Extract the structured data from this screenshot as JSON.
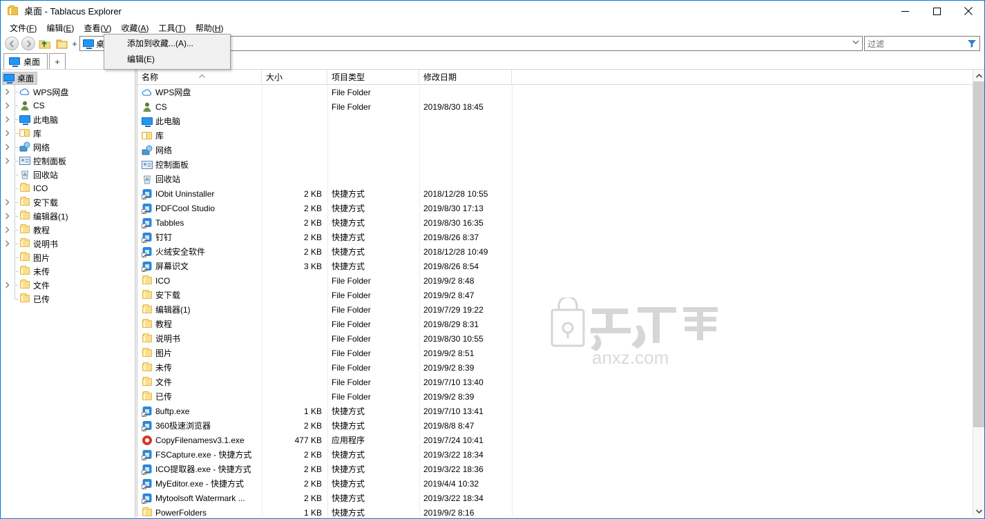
{
  "window": {
    "title": "桌面 - Tablacus Explorer",
    "icon": "folder-icon",
    "controls": {
      "minimize": "–",
      "maximize": "□",
      "close": "✕"
    },
    "accent_color": "#0078d7"
  },
  "menubar": {
    "items": [
      {
        "label": "文件",
        "accel": "F"
      },
      {
        "label": "编辑",
        "accel": "E"
      },
      {
        "label": "查看",
        "accel": "V"
      },
      {
        "label": "收藏",
        "accel": "A"
      },
      {
        "label": "工具",
        "accel": "T"
      },
      {
        "label": "帮助",
        "accel": "H"
      }
    ]
  },
  "open_menu": {
    "parent": "收藏(A)",
    "items": [
      {
        "label": "添加到收藏...(A)..."
      },
      {
        "label": "编辑(E)"
      }
    ]
  },
  "toolbar": {
    "back_icon": "back-arrow-icon",
    "forward_icon": "forward-arrow-icon",
    "up_icon": "up-folder-icon",
    "folder_icon": "folder-icon",
    "plus_label": "+",
    "address": {
      "crumb": "桌面",
      "chevron": "⌄"
    },
    "filter": {
      "placeholder": "过滤",
      "icon": "funnel-icon"
    }
  },
  "tabs": {
    "items": [
      {
        "label": "桌面",
        "icon": "desktop-icon",
        "active": true
      }
    ],
    "add_label": "+"
  },
  "tree": {
    "root": {
      "label": "桌面",
      "icon": "desktop-icon",
      "selected": true
    },
    "items": [
      {
        "label": "WPS网盘",
        "icon": "cloud-icon",
        "expander": true
      },
      {
        "label": "CS",
        "icon": "user-icon",
        "expander": true
      },
      {
        "label": "此电脑",
        "icon": "computer-icon",
        "expander": true
      },
      {
        "label": "库",
        "icon": "library-icon",
        "expander": true
      },
      {
        "label": "网络",
        "icon": "network-icon",
        "expander": true
      },
      {
        "label": "控制面板",
        "icon": "control-panel-icon",
        "expander": true
      },
      {
        "label": "回收站",
        "icon": "recycle-bin-icon",
        "expander": false
      },
      {
        "label": "ICO",
        "icon": "folder-icon",
        "expander": false
      },
      {
        "label": "安下载",
        "icon": "folder-icon",
        "expander": true
      },
      {
        "label": "编辑器(1)",
        "icon": "folder-icon",
        "expander": true
      },
      {
        "label": "教程",
        "icon": "folder-icon",
        "expander": true
      },
      {
        "label": "说明书",
        "icon": "folder-icon",
        "expander": true
      },
      {
        "label": "图片",
        "icon": "folder-icon",
        "expander": false
      },
      {
        "label": "未传",
        "icon": "folder-icon",
        "expander": false
      },
      {
        "label": "文件",
        "icon": "folder-icon",
        "expander": true
      },
      {
        "label": "已传",
        "icon": "folder-icon",
        "expander": false
      }
    ]
  },
  "list": {
    "columns": [
      {
        "label": "名称",
        "sorted": "asc"
      },
      {
        "label": "大小"
      },
      {
        "label": "项目类型"
      },
      {
        "label": "修改日期"
      }
    ],
    "rows": [
      {
        "name": "WPS网盘",
        "icon": "cloud-icon",
        "size": "",
        "type": "File Folder",
        "date": ""
      },
      {
        "name": "CS",
        "icon": "user-icon",
        "size": "",
        "type": "File Folder",
        "date": "2019/8/30 18:45"
      },
      {
        "name": "此电脑",
        "icon": "computer-icon",
        "size": "",
        "type": "",
        "date": ""
      },
      {
        "name": "库",
        "icon": "library-icon",
        "size": "",
        "type": "",
        "date": ""
      },
      {
        "name": "网络",
        "icon": "network-icon",
        "size": "",
        "type": "",
        "date": ""
      },
      {
        "name": "控制面板",
        "icon": "control-panel-icon",
        "size": "",
        "type": "",
        "date": ""
      },
      {
        "name": "回收站",
        "icon": "recycle-bin-icon",
        "size": "",
        "type": "",
        "date": ""
      },
      {
        "name": "IObit Uninstaller",
        "icon": "app-shortcut-icon",
        "size": "2 KB",
        "type": "快捷方式",
        "date": "2018/12/28 10:55"
      },
      {
        "name": "PDFCool Studio",
        "icon": "app-shortcut-icon",
        "size": "2 KB",
        "type": "快捷方式",
        "date": "2019/8/30 17:13"
      },
      {
        "name": "Tabbles",
        "icon": "app-shortcut-icon",
        "size": "2 KB",
        "type": "快捷方式",
        "date": "2019/8/30 16:35"
      },
      {
        "name": "钉钉",
        "icon": "app-shortcut-icon",
        "size": "2 KB",
        "type": "快捷方式",
        "date": "2019/8/26 8:37"
      },
      {
        "name": "火绒安全软件",
        "icon": "app-shortcut-icon",
        "size": "2 KB",
        "type": "快捷方式",
        "date": "2018/12/28 10:49"
      },
      {
        "name": "屏幕识文",
        "icon": "app-shortcut-icon",
        "size": "3 KB",
        "type": "快捷方式",
        "date": "2019/8/26 8:54"
      },
      {
        "name": "ICO",
        "icon": "folder-icon",
        "size": "",
        "type": "File Folder",
        "date": "2019/9/2 8:48"
      },
      {
        "name": "安下载",
        "icon": "folder-icon",
        "size": "",
        "type": "File Folder",
        "date": "2019/9/2 8:47"
      },
      {
        "name": "编辑器(1)",
        "icon": "folder-icon",
        "size": "",
        "type": "File Folder",
        "date": "2019/7/29 19:22"
      },
      {
        "name": "教程",
        "icon": "folder-icon",
        "size": "",
        "type": "File Folder",
        "date": "2019/8/29 8:31"
      },
      {
        "name": "说明书",
        "icon": "folder-icon",
        "size": "",
        "type": "File Folder",
        "date": "2019/8/30 10:55"
      },
      {
        "name": "图片",
        "icon": "folder-icon",
        "size": "",
        "type": "File Folder",
        "date": "2019/9/2 8:51"
      },
      {
        "name": "未传",
        "icon": "folder-icon",
        "size": "",
        "type": "File Folder",
        "date": "2019/9/2 8:39"
      },
      {
        "name": "文件",
        "icon": "folder-icon",
        "size": "",
        "type": "File Folder",
        "date": "2019/7/10 13:40"
      },
      {
        "name": "已传",
        "icon": "folder-icon",
        "size": "",
        "type": "File Folder",
        "date": "2019/9/2 8:39"
      },
      {
        "name": "8uftp.exe",
        "icon": "app-shortcut-icon",
        "size": "1 KB",
        "type": "快捷方式",
        "date": "2019/7/10 13:41"
      },
      {
        "name": "360极速浏览器",
        "icon": "app-shortcut-icon",
        "size": "2 KB",
        "type": "快捷方式",
        "date": "2019/8/8 8:47"
      },
      {
        "name": "CopyFilenamesv3.1.exe",
        "icon": "app-icon",
        "size": "477 KB",
        "type": "应用程序",
        "date": "2019/7/24 10:41"
      },
      {
        "name": "FSCapture.exe - 快捷方式",
        "icon": "app-shortcut-icon",
        "size": "2 KB",
        "type": "快捷方式",
        "date": "2019/3/22 18:34"
      },
      {
        "name": "ICO提取器.exe - 快捷方式",
        "icon": "app-shortcut-icon",
        "size": "2 KB",
        "type": "快捷方式",
        "date": "2019/3/22 18:36"
      },
      {
        "name": "MyEditor.exe - 快捷方式",
        "icon": "app-shortcut-icon",
        "size": "2 KB",
        "type": "快捷方式",
        "date": "2019/4/4 10:32"
      },
      {
        "name": "Mytoolsoft Watermark ...",
        "icon": "app-shortcut-icon",
        "size": "2 KB",
        "type": "快捷方式",
        "date": "2019/3/22 18:34"
      },
      {
        "name": "PowerFolders",
        "icon": "folder-icon",
        "size": "1 KB",
        "type": "快捷方式",
        "date": "2019/9/2 8:16"
      }
    ]
  },
  "watermark": {
    "text_cn": "安下载",
    "text_en": "anxz.com"
  },
  "scrollbar": {
    "up": "⌃",
    "down": "⌄"
  }
}
